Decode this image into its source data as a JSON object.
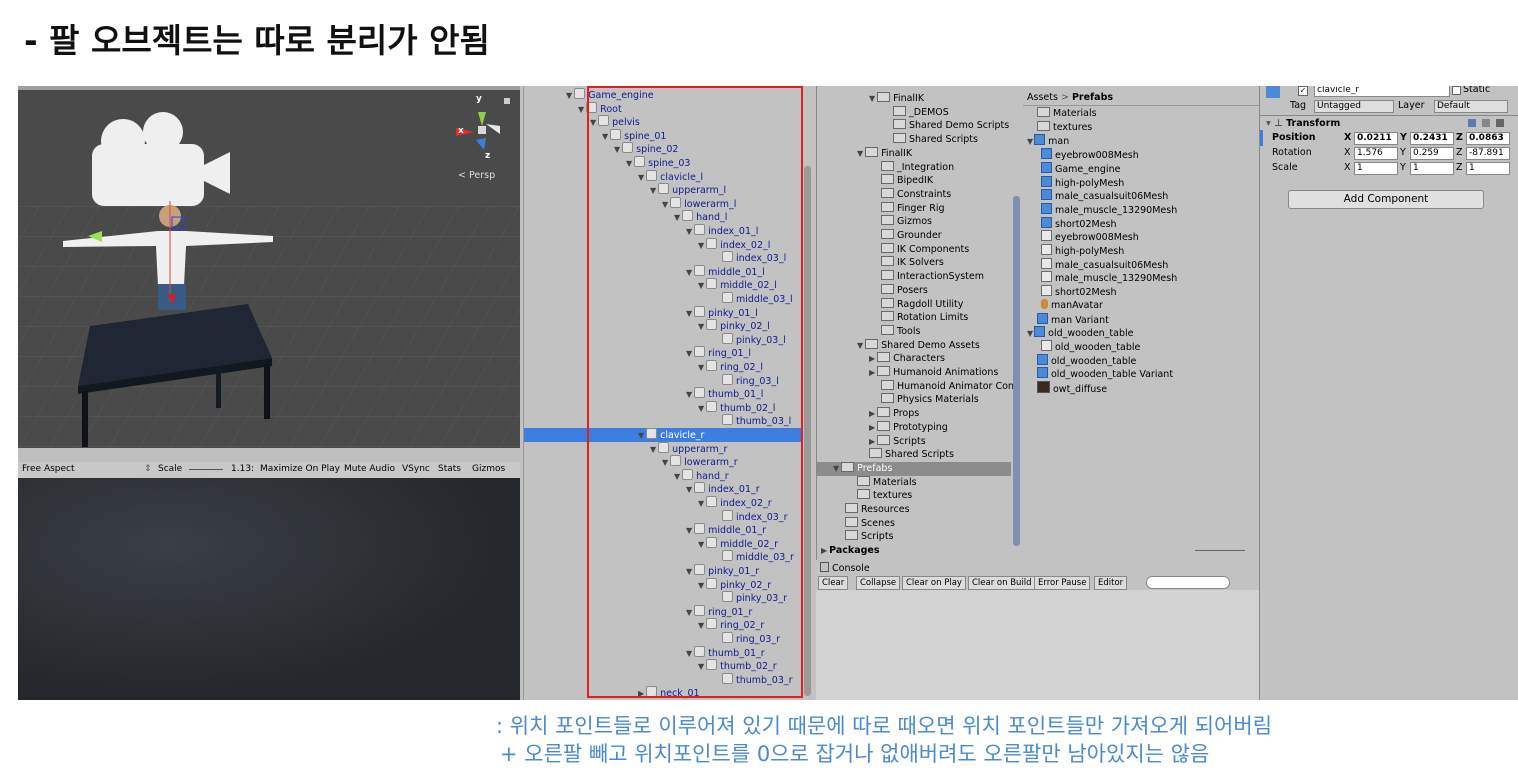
{
  "title": "- 팔 오브젝트는 따로 분리가 안됨",
  "scene": {
    "gizmo_axes": [
      "y",
      "x",
      "z"
    ],
    "persp_label": "< Persp"
  },
  "game_toolbar": {
    "aspect": "Free Aspect",
    "scale_label": "Scale",
    "scale_value": "1.13:",
    "maximize": "Maximize On Play",
    "mute": "Mute Audio",
    "vsync": "VSync",
    "stats": "Stats",
    "gizmos": "Gizmos"
  },
  "hierarchy": {
    "items": [
      {
        "label": "Game_engine",
        "depth": 0,
        "arrow": "down"
      },
      {
        "label": "Root",
        "depth": 1,
        "arrow": "down"
      },
      {
        "label": "pelvis",
        "depth": 2,
        "arrow": "down"
      },
      {
        "label": "spine_01",
        "depth": 3,
        "arrow": "down"
      },
      {
        "label": "spine_02",
        "depth": 4,
        "arrow": "down"
      },
      {
        "label": "spine_03",
        "depth": 5,
        "arrow": "down"
      },
      {
        "label": "clavicle_l",
        "depth": 6,
        "arrow": "down"
      },
      {
        "label": "upperarm_l",
        "depth": 7,
        "arrow": "down"
      },
      {
        "label": "lowerarm_l",
        "depth": 8,
        "arrow": "down"
      },
      {
        "label": "hand_l",
        "depth": 9,
        "arrow": "down"
      },
      {
        "label": "index_01_l",
        "depth": 10,
        "arrow": "down"
      },
      {
        "label": "index_02_l",
        "depth": 11,
        "arrow": "down"
      },
      {
        "label": "index_03_l",
        "depth": 12,
        "arrow": "none"
      },
      {
        "label": "middle_01_l",
        "depth": 10,
        "arrow": "down"
      },
      {
        "label": "middle_02_l",
        "depth": 11,
        "arrow": "down"
      },
      {
        "label": "middle_03_l",
        "depth": 12,
        "arrow": "none"
      },
      {
        "label": "pinky_01_l",
        "depth": 10,
        "arrow": "down"
      },
      {
        "label": "pinky_02_l",
        "depth": 11,
        "arrow": "down"
      },
      {
        "label": "pinky_03_l",
        "depth": 12,
        "arrow": "none"
      },
      {
        "label": "ring_01_l",
        "depth": 10,
        "arrow": "down"
      },
      {
        "label": "ring_02_l",
        "depth": 11,
        "arrow": "down"
      },
      {
        "label": "ring_03_l",
        "depth": 12,
        "arrow": "none"
      },
      {
        "label": "thumb_01_l",
        "depth": 10,
        "arrow": "down"
      },
      {
        "label": "thumb_02_l",
        "depth": 11,
        "arrow": "down"
      },
      {
        "label": "thumb_03_l",
        "depth": 12,
        "arrow": "none"
      },
      {
        "label": "clavicle_r",
        "depth": 6,
        "arrow": "down",
        "selected": true
      },
      {
        "label": "upperarm_r",
        "depth": 7,
        "arrow": "down"
      },
      {
        "label": "lowerarm_r",
        "depth": 8,
        "arrow": "down"
      },
      {
        "label": "hand_r",
        "depth": 9,
        "arrow": "down"
      },
      {
        "label": "index_01_r",
        "depth": 10,
        "arrow": "down"
      },
      {
        "label": "index_02_r",
        "depth": 11,
        "arrow": "down"
      },
      {
        "label": "index_03_r",
        "depth": 12,
        "arrow": "none"
      },
      {
        "label": "middle_01_r",
        "depth": 10,
        "arrow": "down"
      },
      {
        "label": "middle_02_r",
        "depth": 11,
        "arrow": "down"
      },
      {
        "label": "middle_03_r",
        "depth": 12,
        "arrow": "none"
      },
      {
        "label": "pinky_01_r",
        "depth": 10,
        "arrow": "down"
      },
      {
        "label": "pinky_02_r",
        "depth": 11,
        "arrow": "down"
      },
      {
        "label": "pinky_03_r",
        "depth": 12,
        "arrow": "none"
      },
      {
        "label": "ring_01_r",
        "depth": 10,
        "arrow": "down"
      },
      {
        "label": "ring_02_r",
        "depth": 11,
        "arrow": "down"
      },
      {
        "label": "ring_03_r",
        "depth": 12,
        "arrow": "none"
      },
      {
        "label": "thumb_01_r",
        "depth": 10,
        "arrow": "down"
      },
      {
        "label": "thumb_02_r",
        "depth": 11,
        "arrow": "down"
      },
      {
        "label": "thumb_03_r",
        "depth": 12,
        "arrow": "none"
      },
      {
        "label": "neck_01",
        "depth": 6,
        "arrow": "right"
      }
    ]
  },
  "project_tree": {
    "items": [
      {
        "label": "FinalIK",
        "depth": 4,
        "arrow": "down"
      },
      {
        "label": "_DEMOS",
        "depth": 5,
        "arrow": "none"
      },
      {
        "label": "Shared Demo Scripts",
        "depth": 5,
        "arrow": "none"
      },
      {
        "label": "Shared Scripts",
        "depth": 5,
        "arrow": "none"
      },
      {
        "label": "FinalIK",
        "depth": 3,
        "arrow": "down"
      },
      {
        "label": "_Integration",
        "depth": 4,
        "arrow": "none"
      },
      {
        "label": "BipedIK",
        "depth": 4,
        "arrow": "none"
      },
      {
        "label": "Constraints",
        "depth": 4,
        "arrow": "none"
      },
      {
        "label": "Finger Rig",
        "depth": 4,
        "arrow": "none"
      },
      {
        "label": "Gizmos",
        "depth": 4,
        "arrow": "none"
      },
      {
        "label": "Grounder",
        "depth": 4,
        "arrow": "none"
      },
      {
        "label": "IK Components",
        "depth": 4,
        "arrow": "none"
      },
      {
        "label": "IK Solvers",
        "depth": 4,
        "arrow": "none"
      },
      {
        "label": "InteractionSystem",
        "depth": 4,
        "arrow": "none"
      },
      {
        "label": "Posers",
        "depth": 4,
        "arrow": "none"
      },
      {
        "label": "Ragdoll Utility",
        "depth": 4,
        "arrow": "none"
      },
      {
        "label": "Rotation Limits",
        "depth": 4,
        "arrow": "none"
      },
      {
        "label": "Tools",
        "depth": 4,
        "arrow": "none"
      },
      {
        "label": "Shared Demo Assets",
        "depth": 3,
        "arrow": "down"
      },
      {
        "label": "Characters",
        "depth": 4,
        "arrow": "right"
      },
      {
        "label": "Humanoid Animations",
        "depth": 4,
        "arrow": "right"
      },
      {
        "label": "Humanoid Animator Con",
        "depth": 4,
        "arrow": "none"
      },
      {
        "label": "Physics Materials",
        "depth": 4,
        "arrow": "none"
      },
      {
        "label": "Props",
        "depth": 4,
        "arrow": "right"
      },
      {
        "label": "Prototyping",
        "depth": 4,
        "arrow": "right"
      },
      {
        "label": "Scripts",
        "depth": 4,
        "arrow": "right"
      },
      {
        "label": "Shared Scripts",
        "depth": 3,
        "arrow": "none"
      },
      {
        "label": "Prefabs",
        "depth": 1,
        "arrow": "down",
        "selected": true
      },
      {
        "label": "Materials",
        "depth": 2,
        "arrow": "none"
      },
      {
        "label": "textures",
        "depth": 2,
        "arrow": "none"
      },
      {
        "label": "Resources",
        "depth": 1,
        "arrow": "none"
      },
      {
        "label": "Scenes",
        "depth": 1,
        "arrow": "none"
      },
      {
        "label": "Scripts",
        "depth": 1,
        "arrow": "none"
      },
      {
        "label": "Packages",
        "depth": 0,
        "arrow": "right",
        "bold": true
      }
    ]
  },
  "breadcrumb": {
    "root": "Assets",
    "sep": ">",
    "current": "Prefabs"
  },
  "assets": {
    "items": [
      {
        "label": "Materials",
        "icon": "folder",
        "depth": 0
      },
      {
        "label": "textures",
        "icon": "folder",
        "depth": 0
      },
      {
        "label": "man",
        "icon": "prefab",
        "depth": 0,
        "arrow": "down"
      },
      {
        "label": "eyebrow008Mesh",
        "icon": "prefab",
        "depth": 1
      },
      {
        "label": "Game_engine",
        "icon": "prefab",
        "depth": 1
      },
      {
        "label": "high-polyMesh",
        "icon": "prefab",
        "depth": 1
      },
      {
        "label": "male_casualsuit06Mesh",
        "icon": "prefab",
        "depth": 1
      },
      {
        "label": "male_muscle_13290Mesh",
        "icon": "prefab",
        "depth": 1
      },
      {
        "label": "short02Mesh",
        "icon": "prefab",
        "depth": 1
      },
      {
        "label": "eyebrow008Mesh",
        "icon": "mesh",
        "depth": 1
      },
      {
        "label": "high-polyMesh",
        "icon": "mesh",
        "depth": 1
      },
      {
        "label": "male_casualsuit06Mesh",
        "icon": "mesh",
        "depth": 1
      },
      {
        "label": "male_muscle_13290Mesh",
        "icon": "mesh",
        "depth": 1
      },
      {
        "label": "short02Mesh",
        "icon": "mesh",
        "depth": 1
      },
      {
        "label": "manAvatar",
        "icon": "avatar",
        "depth": 1
      },
      {
        "label": "man Variant",
        "icon": "prefab",
        "depth": 0
      },
      {
        "label": "old_wooden_table",
        "icon": "prefab",
        "depth": 0,
        "arrow": "down"
      },
      {
        "label": "old_wooden_table",
        "icon": "mesh",
        "depth": 1
      },
      {
        "label": "old_wooden_table",
        "icon": "prefab",
        "depth": 0
      },
      {
        "label": "old_wooden_table Variant",
        "icon": "prefab",
        "depth": 0
      },
      {
        "label": "owt_diffuse",
        "icon": "texture",
        "depth": 0
      }
    ]
  },
  "console": {
    "tab": "Console",
    "buttons": [
      "Clear",
      "Collapse",
      "Clear on Play",
      "Clear on Build",
      "Error Pause",
      "Editor"
    ]
  },
  "inspector": {
    "name": "clavicle_r",
    "static_label": "Static",
    "tag_label": "Tag",
    "tag_value": "Untagged",
    "layer_label": "Layer",
    "layer_value": "Default",
    "component": "Transform",
    "rows": [
      {
        "label": "Position",
        "x": "0.0211",
        "y": "0.2431",
        "z": "0.0863",
        "bold": true
      },
      {
        "label": "Rotation",
        "x": "1.576",
        "y": "0.259",
        "z": "-87.891"
      },
      {
        "label": "Scale",
        "x": "1",
        "y": "1",
        "z": "1"
      }
    ],
    "add_component": "Add Component"
  },
  "notes": {
    "line1": ": 위치 포인트들로 이루어져 있기 때문에 따로 때오면 위치 포인트들만 가져오게 되어버림",
    "line2": "+ 오른팔 빼고 위치포인트를 0으로 잡거나 없애버려도 오른팔만 남아있지는 않음"
  },
  "colors": {
    "selection": "#3e7de0",
    "highlight_box": "#e02020",
    "note_text": "#4a8ad0",
    "hierarchy_text": "#101c8e"
  }
}
